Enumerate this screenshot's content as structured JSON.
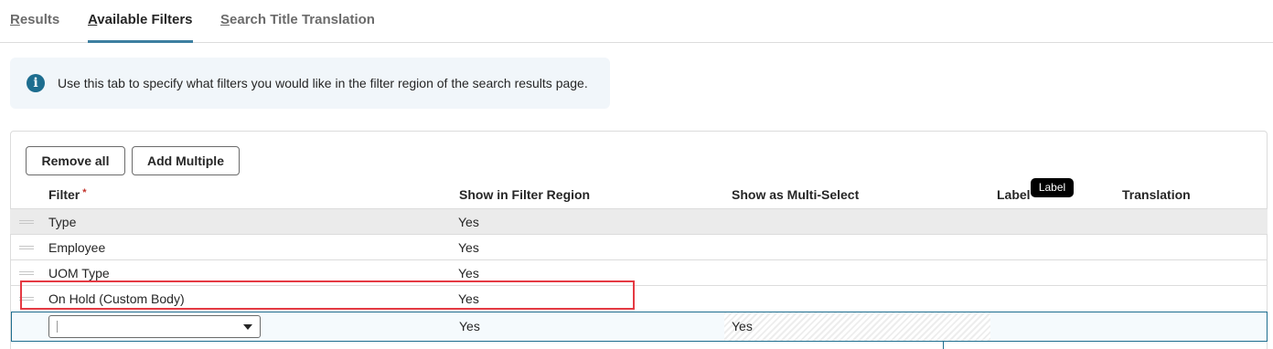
{
  "tabs": [
    {
      "first": "R",
      "rest": "esults"
    },
    {
      "first": "A",
      "rest": "vailable Filters"
    },
    {
      "first": "S",
      "rest": "earch Title Translation"
    }
  ],
  "info": {
    "icon": "info-icon",
    "icon_glyph": "i",
    "text": "Use this tab to specify what filters you would like in the filter region of the search results page."
  },
  "toolbar": {
    "remove_all_label": "Remove all",
    "add_multiple_label": "Add Multiple"
  },
  "table": {
    "columns": {
      "filter": "Filter",
      "required_mark": "*",
      "show_in_region": "Show in Filter Region",
      "show_multi": "Show as Multi-Select",
      "label": "Label",
      "translation": "Translation"
    },
    "tooltip": "Label",
    "rows": [
      {
        "filter": "Type",
        "show_in_region": "Yes"
      },
      {
        "filter": "Employee",
        "show_in_region": "Yes"
      },
      {
        "filter": "UOM Type",
        "show_in_region": "Yes"
      },
      {
        "filter": "On Hold (Custom Body)",
        "show_in_region": "Yes"
      }
    ],
    "edit_row": {
      "filter_value": "",
      "show_in_region": "Yes",
      "show_multi": "Yes"
    }
  },
  "colors": {
    "accent": "#1d6d8f",
    "highlight": "#e53a43",
    "active_tab_underline": "#3d7fa0"
  }
}
